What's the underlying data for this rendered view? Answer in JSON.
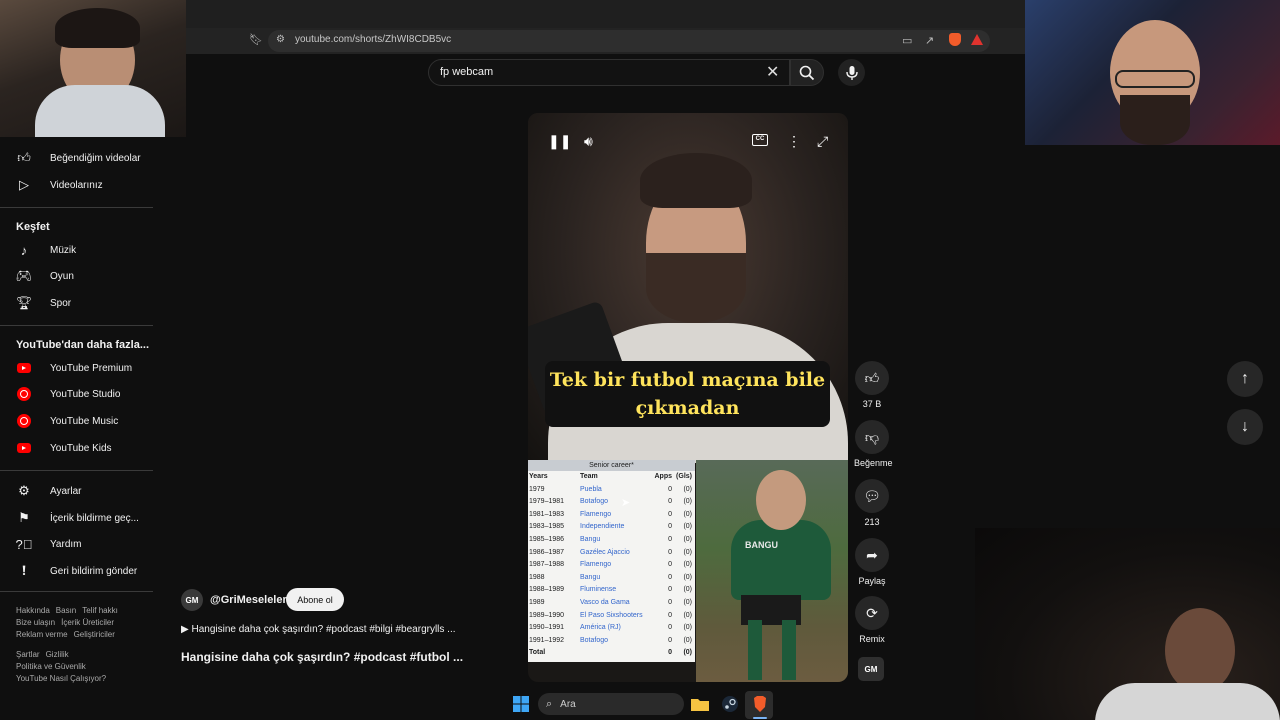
{
  "browser": {
    "url": "youtube.com/shorts/ZhWI8CDB5vc"
  },
  "search": {
    "value": "fp webcam"
  },
  "sidebar": {
    "top_items": [
      {
        "label": "Beğendiğim videolar",
        "icon": "thumb-up-icon"
      },
      {
        "label": "Videolarınız",
        "icon": "video-icon"
      }
    ],
    "explore_heading": "Keşfet",
    "explore_items": [
      {
        "label": "Müzik",
        "icon": "music-note-icon"
      },
      {
        "label": "Oyun",
        "icon": "gamepad-icon"
      },
      {
        "label": "Spor",
        "icon": "trophy-icon"
      }
    ],
    "more_heading": "YouTube'dan daha fazla...",
    "more_items": [
      {
        "label": "YouTube Premium",
        "icon": "youtube-premium-icon"
      },
      {
        "label": "YouTube Studio",
        "icon": "youtube-studio-icon"
      },
      {
        "label": "YouTube Music",
        "icon": "youtube-music-icon"
      },
      {
        "label": "YouTube Kids",
        "icon": "youtube-kids-icon"
      }
    ],
    "settings_items": [
      {
        "label": "Ayarlar",
        "icon": "gear-icon"
      },
      {
        "label": "İçerik bildirme geç...",
        "icon": "flag-icon"
      },
      {
        "label": "Yardım",
        "icon": "help-icon"
      },
      {
        "label": "Geri bildirim gönder",
        "icon": "feedback-icon"
      }
    ],
    "footer": {
      "row1": [
        "Hakkında",
        "Basın",
        "Telif hakkı"
      ],
      "row2": [
        "Bize ulaşın",
        "İçerik Üreticiler"
      ],
      "row3": [
        "Reklam verme",
        "Geliştiriciler"
      ],
      "row4": [
        "Şartlar",
        "Gizlilik"
      ],
      "row5": [
        "Politika ve Güvenlik"
      ],
      "row6": [
        "YouTube Nasıl Çalışıyor?"
      ]
    }
  },
  "video": {
    "caption": "Tek bir futbol maçına bile çıkmadan",
    "wiki_table": {
      "title": "Senior career*",
      "headers": [
        "Years",
        "Team",
        "Apps",
        "(Gls)"
      ],
      "rows": [
        [
          "1979",
          "Puebla",
          "0",
          "(0)"
        ],
        [
          "1979–1981",
          "Botafogo",
          "0",
          "(0)"
        ],
        [
          "1981–1983",
          "Flamengo",
          "0",
          "(0)"
        ],
        [
          "1983–1985",
          "Independiente",
          "0",
          "(0)"
        ],
        [
          "1985–1986",
          "Bangu",
          "0",
          "(0)"
        ],
        [
          "1986–1987",
          "Gazélec Ajaccio",
          "0",
          "(0)"
        ],
        [
          "1987–1988",
          "Flamengo",
          "0",
          "(0)"
        ],
        [
          "1988",
          "Bangu",
          "0",
          "(0)"
        ],
        [
          "1988–1989",
          "Fluminense",
          "0",
          "(0)"
        ],
        [
          "1989",
          "Vasco da Gama",
          "0",
          "(0)"
        ],
        [
          "1989–1990",
          "El Paso Sixshooters",
          "0",
          "(0)"
        ],
        [
          "1990–1991",
          "América (RJ)",
          "0",
          "(0)"
        ],
        [
          "1991–1992",
          "Botafogo",
          "0",
          "(0)"
        ],
        [
          "Total",
          "",
          "0",
          "(0)"
        ]
      ]
    },
    "jersey_text": "BANGU"
  },
  "actions": {
    "like_count": "37 B",
    "dislike_label": "Beğenme",
    "comment_count": "213",
    "share_label": "Paylaş",
    "remix_label": "Remix"
  },
  "channel": {
    "avatar_text": "GM",
    "name": "@GriMeseleler",
    "subscribe_label": "Abone ol",
    "description": "▶ Hangisine daha çok şaşırdın? #podcast #bilgi #beargrylls ...",
    "title": "Hangisine daha çok şaşırdın? #podcast #futbol ..."
  },
  "taskbar": {
    "search_placeholder": "Ara"
  },
  "colors": {
    "background": "#0f0f0f",
    "caption_text": "#ffe45c",
    "youtube_red": "#ff0000"
  }
}
